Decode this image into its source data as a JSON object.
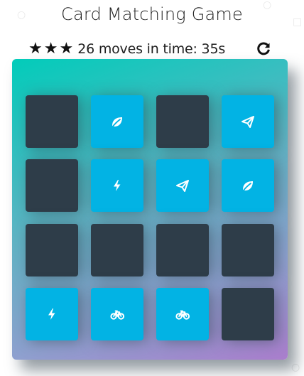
{
  "header": {
    "title": "Card Matching Game"
  },
  "score_panel": {
    "stars": [
      "star-icon",
      "star-icon",
      "star-icon"
    ],
    "status_text": "26 moves in time: 35s",
    "restart_icon": "restart-icon"
  },
  "colors": {
    "card_closed": "#2e3d49",
    "card_open": "#02b3e4",
    "deck_gradient_start": "#02ccba",
    "deck_gradient_end": "#aa7ecd"
  },
  "deck": {
    "cards": [
      {
        "state": "closed",
        "icon": ""
      },
      {
        "state": "open",
        "icon": "leaf"
      },
      {
        "state": "closed",
        "icon": ""
      },
      {
        "state": "open",
        "icon": "paper-plane"
      },
      {
        "state": "closed",
        "icon": ""
      },
      {
        "state": "open",
        "icon": "bolt"
      },
      {
        "state": "open",
        "icon": "paper-plane"
      },
      {
        "state": "open",
        "icon": "leaf"
      },
      {
        "state": "closed",
        "icon": ""
      },
      {
        "state": "closed",
        "icon": ""
      },
      {
        "state": "closed",
        "icon": ""
      },
      {
        "state": "closed",
        "icon": ""
      },
      {
        "state": "open",
        "icon": "bolt"
      },
      {
        "state": "open",
        "icon": "bicycle"
      },
      {
        "state": "open",
        "icon": "bicycle"
      },
      {
        "state": "closed",
        "icon": ""
      }
    ]
  }
}
